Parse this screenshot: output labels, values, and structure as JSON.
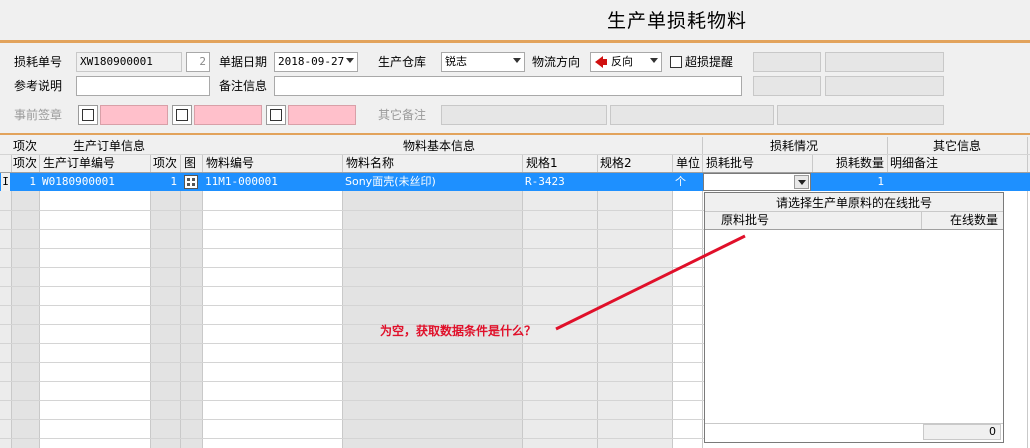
{
  "window": {
    "title": "生产单损耗物料"
  },
  "form": {
    "loss_no_label": "损耗单号",
    "loss_no_value": "XW180900001",
    "loss_no_count": "2",
    "date_label": "单据日期",
    "date_value": "2018-09-27",
    "warehouse_label": "生产仓库",
    "warehouse_value": "锐志",
    "flow_label": "物流方向",
    "flow_value": "反向",
    "over_loss_label": "超损提醒",
    "ref_label": "参考说明",
    "ref_value": "",
    "remark_label": "备注信息",
    "remark_value": "",
    "pre_sign_label": "事前签章",
    "other_remark_label": "其它备注"
  },
  "grid": {
    "group_headers": {
      "idx": "项次",
      "order_info": "生产订单信息",
      "material_info": "物料基本信息",
      "loss_info": "损耗情况",
      "other_info": "其它信息"
    },
    "columns": {
      "idx": "项次",
      "order_no": "生产订单编号",
      "order_idx": "项次",
      "pic": "图",
      "material_no": "物料编号",
      "material_name": "物料名称",
      "spec1": "规格1",
      "spec2": "规格2",
      "unit": "单位",
      "loss_batch": "损耗批号",
      "loss_qty": "损耗数量",
      "detail_remark": "明细备注"
    },
    "row_indicator": "I",
    "rows": [
      {
        "idx": "1",
        "order_no": "W0180900001",
        "order_idx": "1",
        "material_no": "11M1-000001",
        "material_name": "Sony面壳(未丝印)",
        "spec1": "R-3423",
        "spec2": "",
        "unit": "个",
        "loss_batch": "",
        "loss_qty": "1",
        "detail_remark": ""
      }
    ]
  },
  "popup": {
    "title": "请选择生产单原料的在线批号",
    "col_batch": "原料批号",
    "col_qty": "在线数量",
    "footer_total": "0"
  },
  "annotation": {
    "text": "为空，获取数据条件是什么？",
    "color": "#e0102a"
  },
  "colors": {
    "accent_rule": "#e2a35c",
    "selected_row": "#1e90ff",
    "pink_field": "#ffc0cb"
  }
}
